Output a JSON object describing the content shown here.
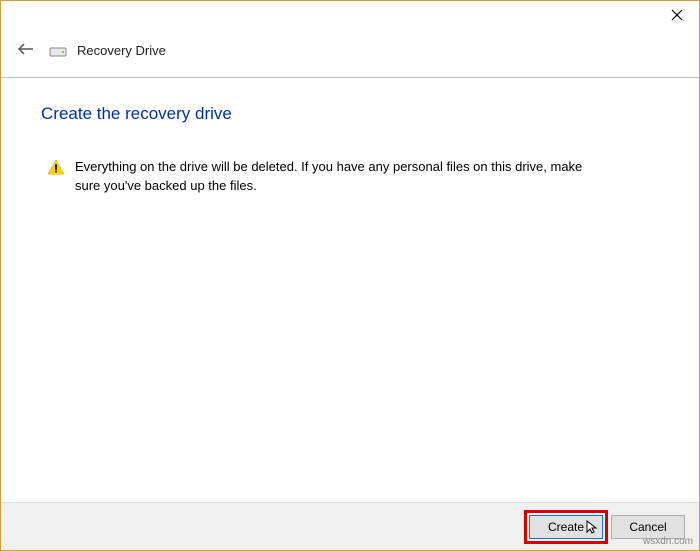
{
  "header": {
    "title": "Recovery Drive"
  },
  "page": {
    "heading": "Create the recovery drive",
    "warning": "Everything on the drive will be deleted. If you have any personal files on this drive, make sure you've backed up the files."
  },
  "footer": {
    "create_label": "Create",
    "cancel_label": "Cancel"
  },
  "watermark": "wsxdn.com"
}
